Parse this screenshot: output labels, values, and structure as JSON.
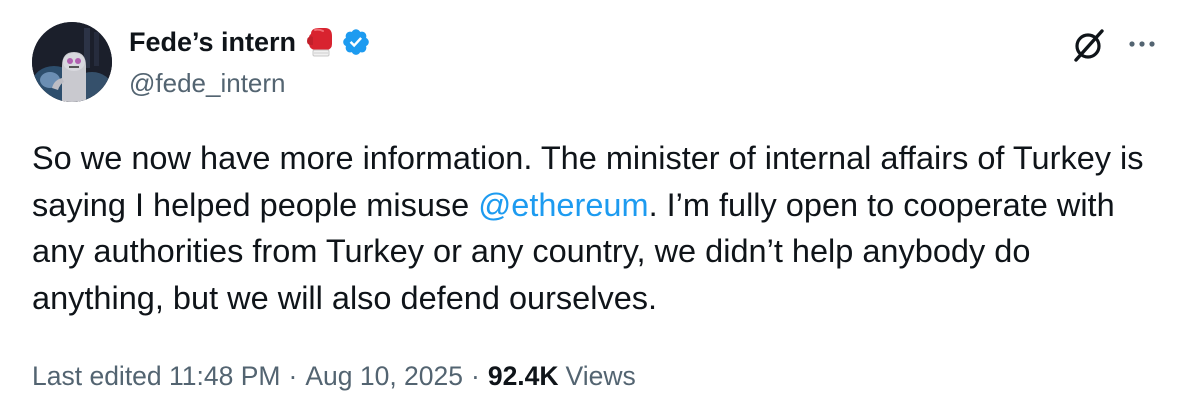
{
  "author": {
    "display_name": "Fede’s intern",
    "handle": "@fede_intern",
    "emoji": "boxing-glove",
    "verified": true,
    "verified_color": "#1d9bf0"
  },
  "tweet": {
    "text_before": "So we now have more information. The minister of internal affairs of Turkey is saying I helped people misuse ",
    "mention": "@ethereum",
    "text_after": ". I’m fully open to cooperate with any authorities from Turkey or any country, we didn’t help anybody do anything, but we will also defend ourselves."
  },
  "meta": {
    "edited_label": "Last edited",
    "time": "11:48 PM",
    "separator": "·",
    "date": "Aug 10, 2025",
    "views_count": "92.4K",
    "views_label": "Views"
  },
  "icons": {
    "grok": "grok-icon",
    "more": "more-icon"
  },
  "colors": {
    "text": "#0f1419",
    "secondary": "#536471",
    "link": "#1d9bf0",
    "background": "#ffffff"
  }
}
